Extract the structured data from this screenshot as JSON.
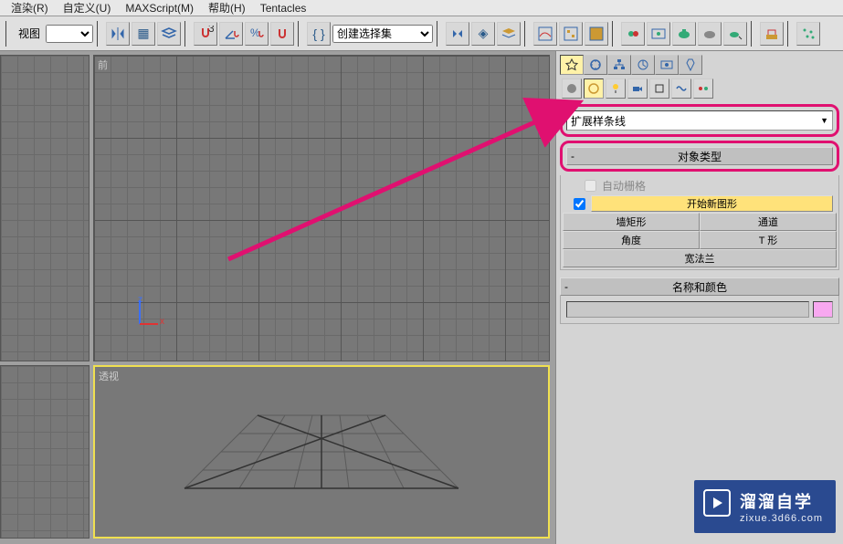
{
  "menu": {
    "render": "渲染(R)",
    "custom": "自定义(U)",
    "maxscript": "MAXScript(M)",
    "help": "帮助(H)",
    "tentacles": "Tentacles"
  },
  "toolbar": {
    "view_label": "视图",
    "selset_placeholder": "创建选择集"
  },
  "viewports": {
    "front": "前",
    "perspective": "透视"
  },
  "panel": {
    "dropdown": "扩展样条线",
    "rollout_objtype": "对象类型",
    "autogrid": "自动栅格",
    "start_new_shape": "开始新图形",
    "btn_wallrect": "墙矩形",
    "btn_channel": "通道",
    "btn_angle": "角度",
    "btn_tee": "T 形",
    "btn_wideflange": "宽法兰",
    "rollout_namecolor": "名称和颜色"
  },
  "watermark": {
    "title": "溜溜自学",
    "url": "zixue.3d66.com"
  },
  "axis": {
    "z": "z",
    "x": "x"
  }
}
